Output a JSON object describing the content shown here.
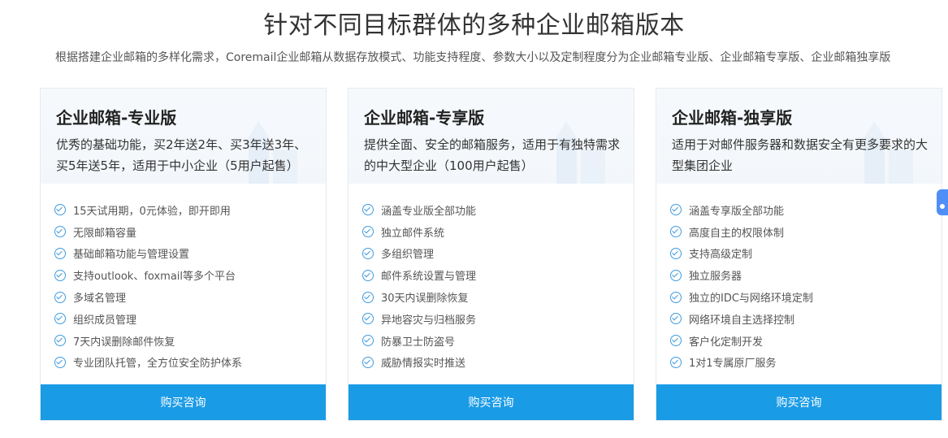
{
  "page": {
    "title": "针对不同目标群体的多种企业邮箱版本",
    "description": "根据搭建企业邮箱的多样化需求，Coremail企业邮箱从数据存放模式、功能支持程度、参数大小以及定制程度分为企业邮箱专业版、企业邮箱专享版、企业邮箱独享版"
  },
  "plans": [
    {
      "name": "企业邮箱-专业版",
      "intro": "优秀的基础功能，买2年送2年、买3年送3年、买5年送5年，适用于中小企业（5用户起售）",
      "features": [
        "15天试用期，0元体验，即开即用",
        "无限邮箱容量",
        "基础邮箱功能与管理设置",
        "支持outlook、foxmail等多个平台",
        "多域名管理",
        "组织成员管理",
        "7天内误删除邮件恢复",
        "专业团队托管，全方位安全防护体系"
      ],
      "button": "购买咨询"
    },
    {
      "name": "企业邮箱-专享版",
      "intro": "提供全面、安全的邮箱服务，适用于有独特需求的中大型企业（100用户起售）",
      "features": [
        "涵盖专业版全部功能",
        "独立邮件系统",
        "多组织管理",
        "邮件系统设置与管理",
        "30天内误删除恢复",
        "异地容灾与归档服务",
        "防暴卫士防盗号",
        "威胁情报实时推送"
      ],
      "button": "购买咨询"
    },
    {
      "name": "企业邮箱-独享版",
      "intro": "适用于对邮件服务器和数据安全有更多要求的大型集团企业",
      "features": [
        "涵盖专享版全部功能",
        "高度自主的权限体制",
        "支持高级定制",
        "独立服务器",
        "独立的IDC与网络环境定制",
        "网络环境自主选择控制",
        "客户化定制开发",
        "1对1专属原厂服务"
      ],
      "button": "购买咨询"
    }
  ],
  "icons": {
    "feature": "check-circle-icon",
    "decoration": "building-icon",
    "side": "chat-icon"
  },
  "colors": {
    "accent": "#1a9be6",
    "check": "#3f9be0"
  }
}
